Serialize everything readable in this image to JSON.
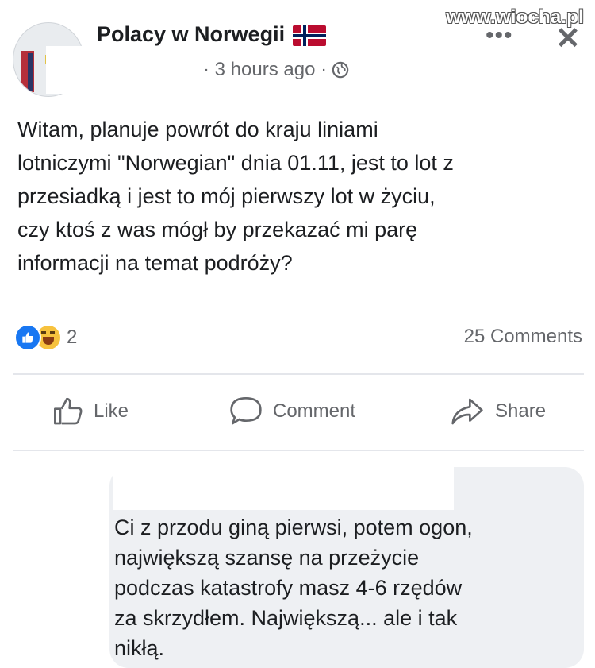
{
  "watermark": "www.wiocha.pl",
  "post": {
    "group_name": "Polacy w Norwegii",
    "meta_time": "· 3 hours ago ·",
    "body_lines": [
      "Witam, planuje powrót do kraju liniami",
      "lotniczymi \"Norwegian\" dnia 01.11, jest to lot z",
      "przesiadką i  jest to mój pierwszy lot w życiu,",
      "czy ktoś z was mógł by przekazać mi parę",
      "informacji na temat podróży?"
    ],
    "reaction_count": "2",
    "comments_count": "25 Comments"
  },
  "actions": {
    "like": "Like",
    "comment": "Comment",
    "share": "Share"
  },
  "comment": {
    "lines": [
      "Ci z przodu giną pierwsi, potem ogon,",
      "największą szansę na przeżycie",
      "podczas katastrofy masz 4-6 rzędów",
      "za skrzydłem. Największą... ale i tak",
      "nikłą."
    ]
  },
  "icons": {
    "flag": "norway-flag-icon",
    "more": "more-options-icon",
    "close": "close-icon",
    "privacy": "globe-icon",
    "like_reaction": "like-reaction-icon",
    "haha_reaction": "haha-reaction-icon",
    "like": "thumbs-up-icon",
    "comment": "comment-icon",
    "share": "share-icon"
  },
  "colors": {
    "text": "#1c1e21",
    "secondary": "#65676b",
    "like_blue": "#1877f2",
    "haha_yellow": "#f7c23e",
    "bubble": "#eef0f3"
  }
}
